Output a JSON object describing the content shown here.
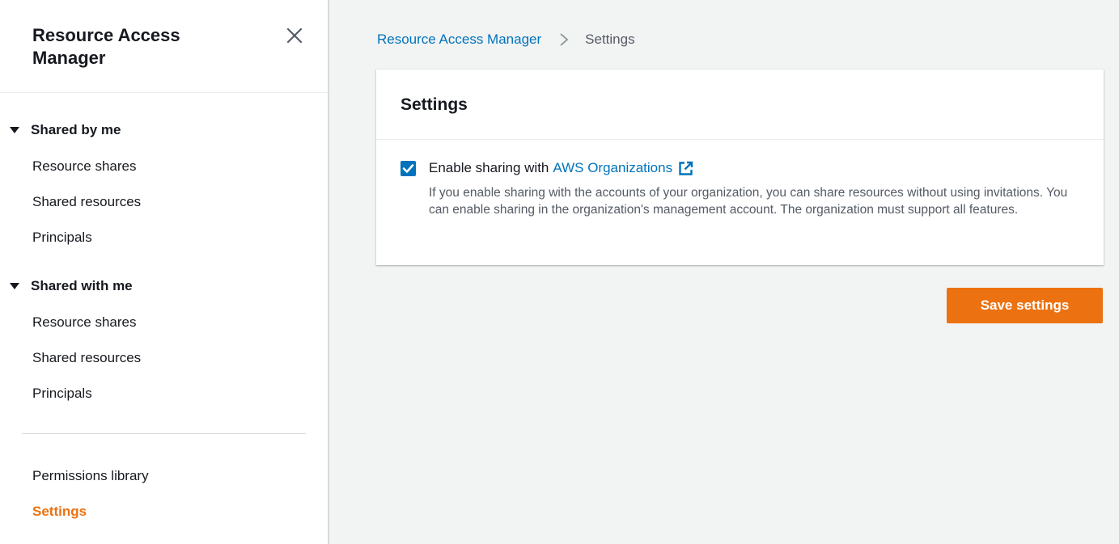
{
  "sidebar": {
    "title": "Resource Access Manager",
    "close_icon": "close-icon",
    "sections": [
      {
        "heading": "Shared by me",
        "items": [
          "Resource shares",
          "Shared resources",
          "Principals"
        ]
      },
      {
        "heading": "Shared with me",
        "items": [
          "Resource shares",
          "Shared resources",
          "Principals"
        ]
      }
    ],
    "bottom_items": [
      {
        "label": "Permissions library",
        "active": false
      },
      {
        "label": "Settings",
        "active": true
      }
    ]
  },
  "breadcrumb": {
    "parent": "Resource Access Manager",
    "current": "Settings"
  },
  "panel": {
    "title": "Settings",
    "checkbox_checked": true,
    "checkbox_label": "Enable sharing with",
    "checkbox_link": "AWS Organizations",
    "description": "If you enable sharing with the accounts of your organization, you can share resources without using invitations. You can enable sharing in the organization's management account. The organization must support all features."
  },
  "actions": {
    "save_label": "Save settings"
  },
  "colors": {
    "accent": "#ec7211",
    "link": "#0073bb",
    "text": "#16191f",
    "muted": "#545b64",
    "background": "#f2f3f3"
  }
}
